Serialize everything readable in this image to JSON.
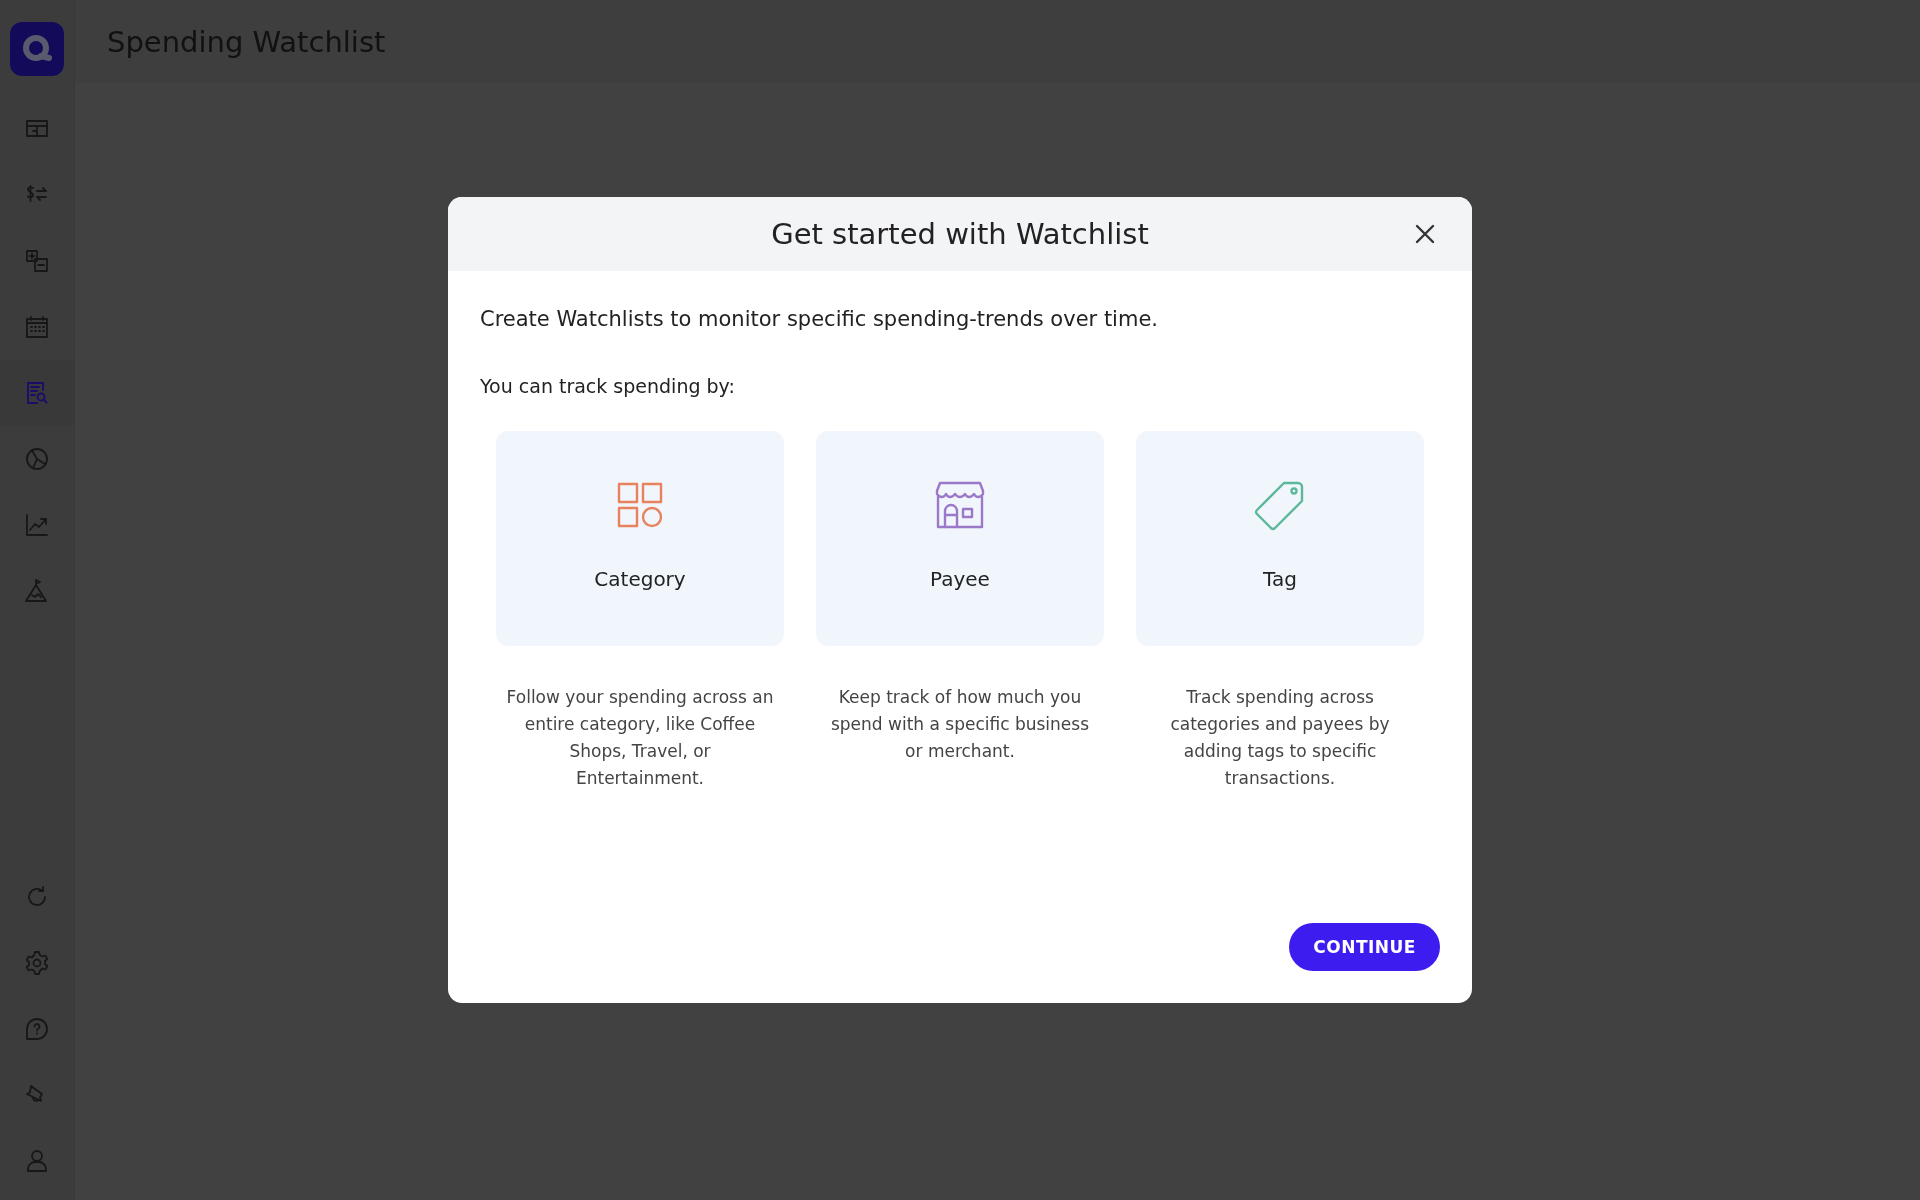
{
  "page": {
    "title": "Spending Watchlist"
  },
  "sidebar": {
    "items": [
      {
        "selected": false
      },
      {
        "selected": false
      },
      {
        "selected": false
      },
      {
        "selected": false
      },
      {
        "selected": true
      },
      {
        "selected": false
      },
      {
        "selected": false
      },
      {
        "selected": false
      }
    ]
  },
  "dialog": {
    "title": "Get started with Watchlist",
    "intro": "Create Watchlists to monitor specific spending-trends over time.",
    "prompt": "You can track spending by:",
    "options": [
      {
        "kind": "grid",
        "label": "Category",
        "color": "#e8825e",
        "description": "Follow your spending across an entire category, like Coffee Shops, Travel, or Entertainment."
      },
      {
        "kind": "store",
        "label": "Payee",
        "color": "#9b78c8",
        "description": "Keep track of how much you spend with a specific business or merchant."
      },
      {
        "kind": "tag",
        "label": "Tag",
        "color": "#5bb89a",
        "description": "Track spending across categories and payees by adding tags to specific transactions."
      }
    ],
    "button": "CONTINUE"
  }
}
